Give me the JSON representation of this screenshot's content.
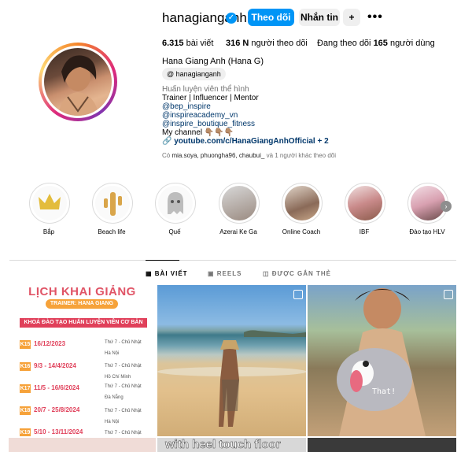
{
  "profile": {
    "username": "hanagianganh",
    "verified_glyph": "✓",
    "follow_label": "Theo dõi",
    "message_label": "Nhắn tin",
    "add_user_glyph": "+",
    "more_glyph": "•••",
    "posts_count": "6.315",
    "posts_label": "bài viết",
    "followers_count": "316 N",
    "followers_label": "người theo dõi",
    "following_prefix": "Đang theo dõi",
    "following_count": "165",
    "following_label": "người dùng",
    "full_name": "Hana Giang Anh (Hana G)",
    "threads_handle": "hanagianganh",
    "category": "Huấn luyện viên thể hình",
    "bio_line1": "Trainer | Influencer | Mentor",
    "bio_mention1": "@bep_inspire",
    "bio_mention2": "@inspireacademy_vn",
    "bio_mention3": "@inspire_boutique_fitness",
    "bio_line5": "My channel 👇🏽👇🏽👇🏽",
    "link_text": "youtube.com/c/HanaGiangAnhOfficial + 2",
    "followed_by_prefix": "Có",
    "followed_by_names": "mia.soya, phuongha96, chaubui_",
    "followed_by_suffix": "và 1 người khác theo dõi"
  },
  "highlights": [
    {
      "label": "Bắp",
      "icon": "crown-icon"
    },
    {
      "label": "Beach life",
      "icon": "cactus-icon"
    },
    {
      "label": "Quế",
      "icon": "ghost-icon"
    },
    {
      "label": "Azerai Ke Ga",
      "icon": "photo"
    },
    {
      "label": "Online Coach",
      "icon": "photo"
    },
    {
      "label": "IBF",
      "icon": "photo"
    },
    {
      "label": "Đào tạo HLV",
      "icon": "photo"
    }
  ],
  "tabs": [
    {
      "label": "BÀI VIẾT",
      "icon": "grid-icon",
      "active": true
    },
    {
      "label": "REELS",
      "icon": "reels-icon",
      "active": false
    },
    {
      "label": "ĐƯỢC GẮN THẺ",
      "icon": "tag-icon",
      "active": false
    }
  ],
  "post1": {
    "title": "LỊCH KHAI GIẢNG",
    "trainer": "TRAINER: HANA GIANG ANH",
    "course": "KHOÁ ĐÀO TẠO HUẤN LUYỆN VIÊN CƠ BẢN",
    "rows": [
      {
        "k": "K15",
        "date": "16/12/2023",
        "day": "Thứ 7 - Chủ Nhật",
        "city": "Hà Nội"
      },
      {
        "k": "K16",
        "date": "9/3 - 14/4/2024",
        "day": "Thứ 7 - Chủ Nhật",
        "city": "Hồ Chí Minh"
      },
      {
        "k": "K17",
        "date": "11/5 - 16/6/2024",
        "day": "Thứ 7 - Chủ Nhật",
        "city": "Đà Nẵng"
      },
      {
        "k": "K18",
        "date": "20/7 - 25/8/2024",
        "day": "Thứ 7 - Chủ Nhật",
        "city": "Hà Nội"
      },
      {
        "k": "K19",
        "date": "5/10 - 13/11/2024",
        "day": "Thứ 7 - Chủ Nhật",
        "city": ""
      }
    ]
  },
  "post3_caption": "That!",
  "post5_caption": "with heel touch floor",
  "colors": {
    "accent": "#0095f6",
    "link": "#00376b",
    "poster_red": "#e05466",
    "poster_orange": "#f6a23a"
  }
}
